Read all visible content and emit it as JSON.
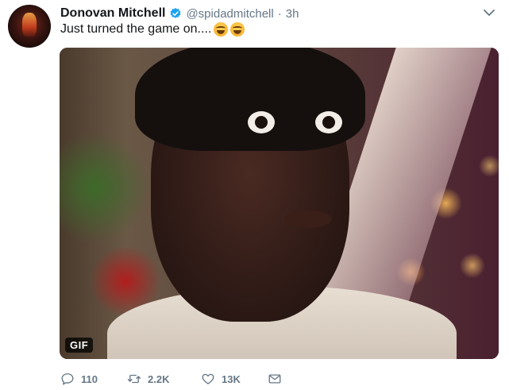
{
  "tweet": {
    "author": {
      "name": "Donovan Mitchell",
      "handle": "@spidadmitchell",
      "verified": true
    },
    "separator": "·",
    "time": "3h",
    "text": "Just turned the game on....",
    "emojis": [
      "face-with-tears-of-joy",
      "face-with-tears-of-joy"
    ],
    "media": {
      "type": "GIF",
      "badge": "GIF"
    },
    "actions": {
      "replies": "110",
      "retweets": "2.2K",
      "likes": "13K"
    }
  },
  "colors": {
    "text": "#14171a",
    "secondary": "#657786",
    "verified": "#1da1f2"
  },
  "icons": {
    "verified": "verified-badge-icon",
    "menu": "chevron-down-icon",
    "reply": "reply-icon",
    "retweet": "retweet-icon",
    "like": "heart-icon",
    "dm": "envelope-icon"
  }
}
